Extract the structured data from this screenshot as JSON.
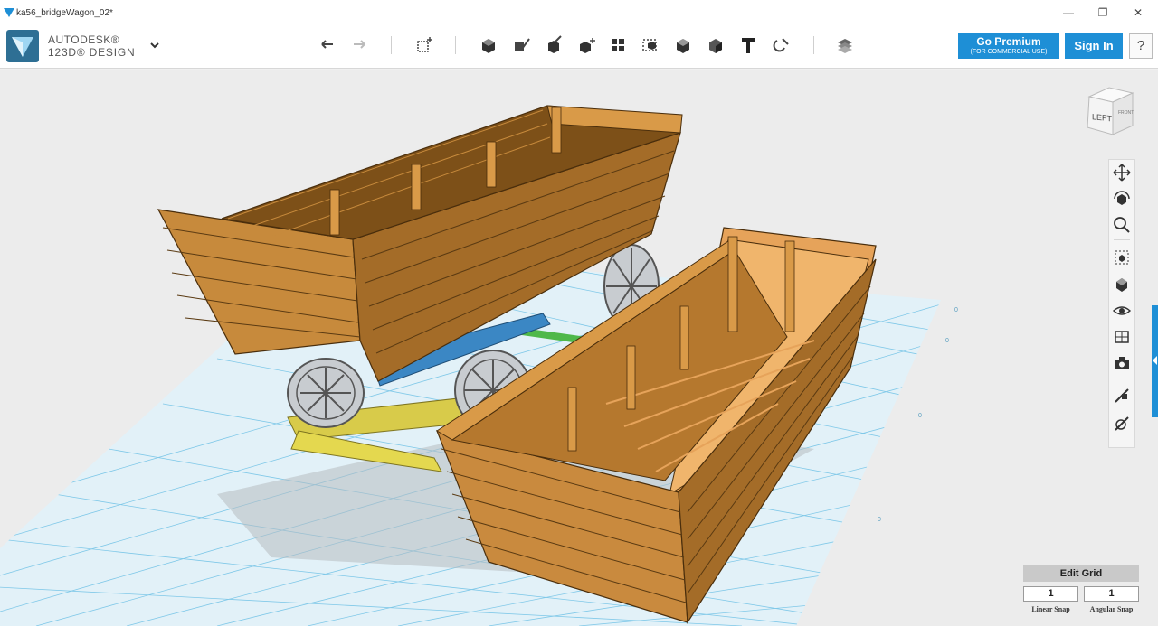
{
  "window": {
    "title": "ka56_bridgeWagon_02*",
    "controls": {
      "minimize": "—",
      "restore": "❐",
      "close": "✕"
    }
  },
  "brand": {
    "line1": "AUTODESK®",
    "line2": "123D® DESIGN"
  },
  "toolbar": {
    "icons": [
      "undo-icon",
      "redo-icon",
      "primitives-icon",
      "sketch-icon",
      "construct-icon",
      "modify-icon",
      "pattern-icon",
      "grouping-icon",
      "combine-icon",
      "measure-icon",
      "text-icon",
      "snap-icon",
      "material-icon"
    ]
  },
  "premium": {
    "label": "Go Premium",
    "sublabel": "(FOR COMMERCIAL USE)"
  },
  "signin": {
    "label": "Sign In"
  },
  "help": {
    "label": "?"
  },
  "viewcube": {
    "face": "LEFT",
    "side": "FRONT"
  },
  "navbar": {
    "icons": [
      "pan-icon",
      "orbit-icon",
      "zoom-icon",
      "fit-icon",
      "view-icon",
      "visibility-icon",
      "material-view-icon",
      "camera-icon",
      "snap-tool-icon",
      "settings-icon"
    ]
  },
  "grid": {
    "edit_label": "Edit Grid",
    "linear_value": "1",
    "angular_value": "1",
    "linear_label": "Linear Snap",
    "angular_label": "Angular Snap"
  },
  "colors": {
    "accent": "#1e8fd6",
    "wood": "#c98a3e",
    "wood_dark": "#8a5a20",
    "grid_line": "#7fc8e8"
  }
}
